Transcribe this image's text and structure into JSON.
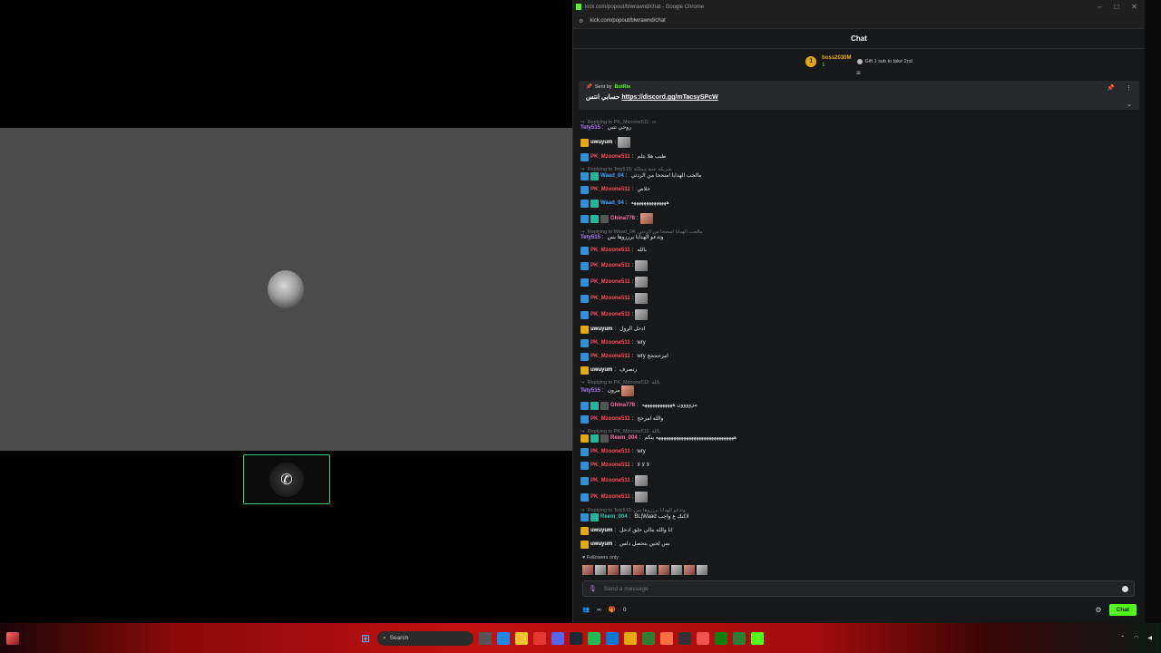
{
  "window": {
    "title": "kick.com/popout/blwrawnd/chat - Google Chrome",
    "url": "kick.com/popout/blwrawnd/chat"
  },
  "chat": {
    "header": "Chat",
    "gift_leader": {
      "rank": "1",
      "username": "boss2030M",
      "count": "1"
    },
    "gift_tip": "Gift 1 sub to take 2nd",
    "pinned": {
      "sent_by_label": "Sent by",
      "bot": "BotRix",
      "prefix": "حسابي انتس",
      "link": "https://discord.gg/mTacsySPcW"
    },
    "messages": [
      {
        "reply": "Replying to PK_Mzoone511: ءء",
        "user": "Tety515",
        "color": "purple",
        "badges": [],
        "text": "روحي تتبي"
      },
      {
        "user": "uwuyum",
        "color": "white",
        "badges": [
          "gold"
        ],
        "text": "",
        "emote": true
      },
      {
        "user": "PK_Mzoone511",
        "color": "red",
        "badges": [
          "blue"
        ],
        "text": "طيب هلا بتلم"
      },
      {
        "reply": "Replying to Tety515: شريكة عتبة مملكة",
        "user": "Waad_04",
        "color": "blue",
        "badges": [
          "blue",
          "green"
        ],
        "text": "مالجب الهدايا امتجحا من الردتي"
      },
      {
        "user": "PK_Mzoone511",
        "color": "red",
        "badges": [
          "blue"
        ],
        "text": "خلاص"
      },
      {
        "user": "Waad_04",
        "color": "blue",
        "badges": [
          "blue",
          "green"
        ],
        "text": "ههههههههههههههه"
      },
      {
        "user": "Ghina778",
        "color": "pink",
        "badges": [
          "blue",
          "green",
          "gray"
        ],
        "text": "",
        "emote": true,
        "warm": true
      },
      {
        "reply": "Replying to Waad_04: مالجب الهدايا امتجحا من الردتي",
        "user": "Tety515",
        "color": "purple",
        "badges": [],
        "text": "وتدعو الهدايا يرززوها بس"
      },
      {
        "user": "PK_Mzoone511",
        "color": "red",
        "badges": [
          "blue"
        ],
        "text": "بالله"
      },
      {
        "user": "PK_Mzoone511",
        "color": "red",
        "badges": [
          "blue"
        ],
        "text": "",
        "emote": true
      },
      {
        "user": "PK_Mzoone511",
        "color": "red",
        "badges": [
          "blue"
        ],
        "text": "",
        "emote": true
      },
      {
        "user": "PK_Mzoone511",
        "color": "red",
        "badges": [
          "blue"
        ],
        "text": "",
        "emote": true
      },
      {
        "user": "PK_Mzoone511",
        "color": "red",
        "badges": [
          "blue"
        ],
        "text": "",
        "emote": true
      },
      {
        "user": "uwuyum",
        "color": "white",
        "badges": [
          "gold"
        ],
        "text": "ادخل الرول"
      },
      {
        "user": "PK_Mzoone511",
        "color": "red",
        "badges": [
          "blue"
        ],
        "text": "wry"
      },
      {
        "user": "PK_Mzoone511",
        "color": "red",
        "badges": [
          "blue"
        ],
        "text": "wry امزحححح"
      },
      {
        "user": "uwuyum",
        "color": "white",
        "badges": [
          "gold"
        ],
        "text": "رتصرف"
      },
      {
        "reply": "Replying to PK_Mzoone511: بالله",
        "user": "Tety515",
        "color": "purple",
        "badges": [],
        "text": "مزون",
        "emote": true,
        "warm": true
      },
      {
        "user": "Ghina778",
        "color": "pink",
        "badges": [
          "blue",
          "green",
          "gray"
        ],
        "text": "مزوووون ههههههههههههه"
      },
      {
        "user": "PK_Mzoone511",
        "color": "red",
        "badges": [
          "blue"
        ],
        "text": "والله امزحح"
      },
      {
        "reply": "Replying to PK_Mzoone511: بالله",
        "user": "Reem_004",
        "color": "pink",
        "badges": [
          "gold",
          "green",
          "gray"
        ],
        "text": "هههههههههههههههههههههههههههههههه ينكم"
      },
      {
        "user": "PK_Mzoone511",
        "color": "red",
        "badges": [
          "blue"
        ],
        "text": "wry"
      },
      {
        "user": "PK_Mzoone511",
        "color": "red",
        "badges": [
          "blue"
        ],
        "text": "لا لا لا"
      },
      {
        "user": "PK_Mzoone511",
        "color": "red",
        "badges": [
          "blue"
        ],
        "text": "",
        "emote": true
      },
      {
        "user": "PK_Mzoone511",
        "color": "red",
        "badges": [
          "blue"
        ],
        "text": "",
        "emote": true
      },
      {
        "reply": "Replying to Tety515: وتدعو الهدايا يرززوها بس",
        "user": "Reem_004",
        "color": "teal",
        "badges": [
          "blue",
          "green"
        ],
        "text": "BL|Waad لاكنك ع واجب"
      },
      {
        "user": "uwuyum",
        "color": "white",
        "badges": [
          "gold"
        ],
        "text": "انا والله مالي حلق ادخل"
      },
      {
        "user": "uwuyum",
        "color": "white",
        "badges": [
          "gold"
        ],
        "text": "بس لحين بتحصل دلس"
      }
    ],
    "followers_only": "Followers only",
    "input_placeholder": "Send a message",
    "footer": {
      "viewers": "∞",
      "gifts": "0",
      "send_label": "Chat"
    }
  },
  "taskbar": {
    "search_placeholder": "Search"
  }
}
